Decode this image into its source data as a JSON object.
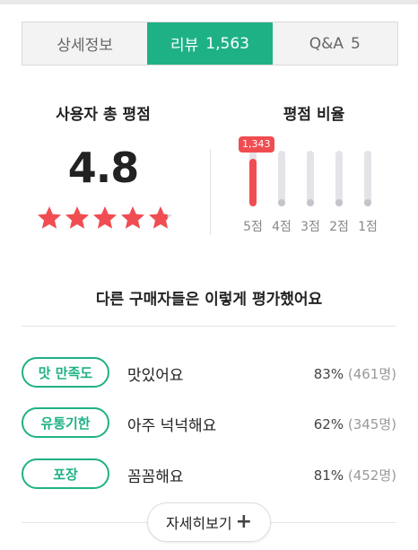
{
  "tabs": [
    {
      "label": "상세정보",
      "count": ""
    },
    {
      "label": "리뷰",
      "count": "1,563"
    },
    {
      "label": "Q&A",
      "count": "5"
    }
  ],
  "rating": {
    "title": "사용자 총 평점",
    "score": "4.8",
    "stars_value": 4.8,
    "stars_max": 5
  },
  "ratio": {
    "title": "평점 비율",
    "bubble": "1,343",
    "levels": [
      {
        "label": "5점",
        "fraction": 0.86
      },
      {
        "label": "4점",
        "fraction": 0.0
      },
      {
        "label": "3점",
        "fraction": 0.0
      },
      {
        "label": "2점",
        "fraction": 0.0
      },
      {
        "label": "1점",
        "fraction": 0.0
      }
    ]
  },
  "evaluation": {
    "title": "다른 구매자들은 이렇게 평가했어요",
    "rows": [
      {
        "tag": "맛 만족도",
        "text": "맛있어요",
        "percent": "83%",
        "count": "(461명)"
      },
      {
        "tag": "유통기한",
        "text": "아주 넉넉해요",
        "percent": "62%",
        "count": "(345명)"
      },
      {
        "tag": "포장",
        "text": "꼼꼼해요",
        "percent": "81%",
        "count": "(452명)"
      }
    ]
  },
  "more_button": {
    "label": "자세히보기",
    "icon": "plus-icon"
  },
  "colors": {
    "accent": "#1fb186",
    "star": "#f04d52",
    "bar": "#f04d52"
  }
}
